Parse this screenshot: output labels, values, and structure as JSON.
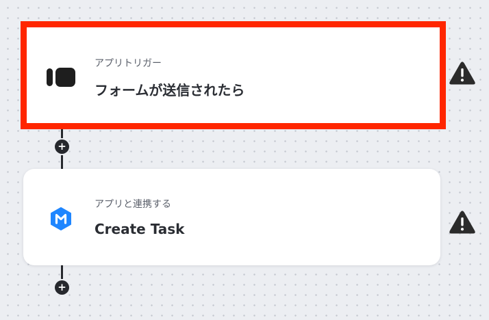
{
  "steps": [
    {
      "kind": "アプリトリガー",
      "title": "フォームが送信されたら",
      "icon": "form-trigger-icon",
      "selected": true,
      "warning_icon": "warning-icon"
    },
    {
      "kind": "アプリと連携する",
      "title": "Create Task",
      "icon": "meistertask-icon",
      "selected": false,
      "warning_icon": "warning-icon"
    }
  ],
  "add_step_symbol": "+",
  "colors": {
    "canvas_bg": "#eceef2",
    "selection_border": "#ff2600",
    "connector": "#26282d",
    "app_icon_blue": "#1f86ff",
    "warning": "#2b2b2b"
  }
}
